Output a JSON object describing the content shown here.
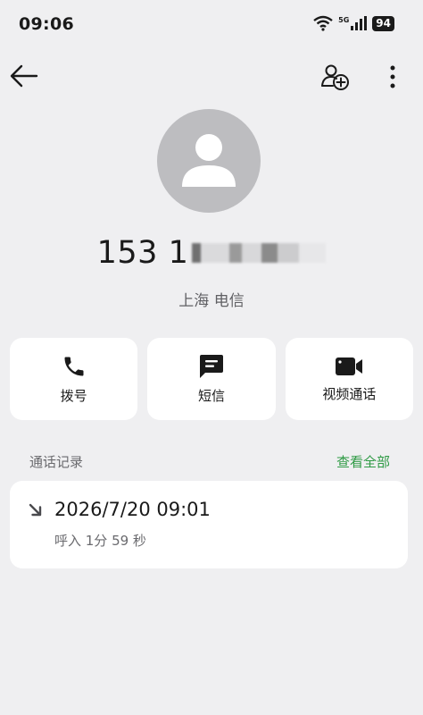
{
  "status_bar": {
    "time": "09:06",
    "battery": "94",
    "network": "5G"
  },
  "contact": {
    "phone_number": "153 1",
    "location": "上海 电信"
  },
  "actions": [
    {
      "label": "拨号",
      "icon": "phone-icon"
    },
    {
      "label": "短信",
      "icon": "message-icon"
    },
    {
      "label": "视频通话",
      "icon": "video-call-icon"
    }
  ],
  "call_history": {
    "title": "通话记录",
    "view_all": "查看全部",
    "records": [
      {
        "datetime": "2026/7/20 09:01",
        "detail": "呼入 1分 59 秒",
        "direction": "incoming-arrow-icon"
      }
    ]
  },
  "colors": {
    "accent": "#2e9a44",
    "background": "#efeff1",
    "card": "#ffffff",
    "avatar": "#bdbdc0"
  }
}
